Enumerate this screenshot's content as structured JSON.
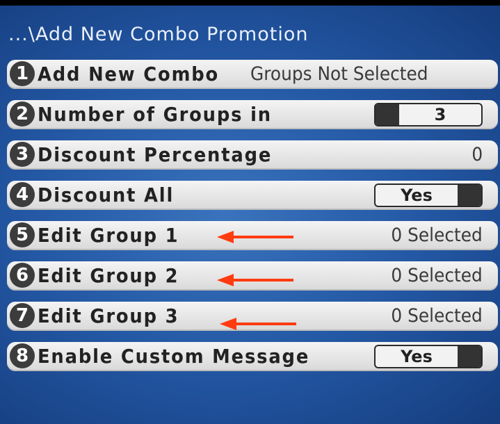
{
  "screen": {
    "title": "...\\Add New Combo Promotion"
  },
  "menu": {
    "items": [
      {
        "number": "1",
        "label": "Add New Combo",
        "value": "Groups Not Selected"
      },
      {
        "number": "2",
        "label": "Number of Groups in",
        "value": "3"
      },
      {
        "number": "3",
        "label": "Discount Percentage",
        "value": "0"
      },
      {
        "number": "4",
        "label": "Discount All",
        "value": "Yes"
      },
      {
        "number": "5",
        "label": "Edit Group 1",
        "value": "0 Selected"
      },
      {
        "number": "6",
        "label": "Edit Group 2",
        "value": "0 Selected"
      },
      {
        "number": "7",
        "label": "Edit Group 3",
        "value": "0 Selected"
      },
      {
        "number": "8",
        "label": "Enable Custom Message",
        "value": "Yes"
      }
    ]
  },
  "annotations": {
    "arrow_color": "#ff3b10",
    "arrow_targets": [
      "Edit Group 1",
      "Edit Group 2",
      "Edit Group 3"
    ]
  },
  "colors": {
    "background": "#2357a3",
    "row": "#e6e6e6",
    "badge": "#3c3c3c"
  }
}
